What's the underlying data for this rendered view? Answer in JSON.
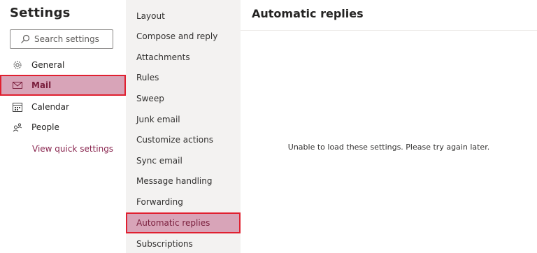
{
  "settings": {
    "title": "Settings",
    "search_placeholder": "Search settings",
    "nav": [
      {
        "label": "General",
        "icon": "gear-icon"
      },
      {
        "label": "Mail",
        "icon": "mail-icon",
        "selected": true
      },
      {
        "label": "Calendar",
        "icon": "calendar-icon"
      },
      {
        "label": "People",
        "icon": "people-icon"
      }
    ],
    "view_quick_settings": "View quick settings"
  },
  "mail_menu": {
    "items": [
      "Layout",
      "Compose and reply",
      "Attachments",
      "Rules",
      "Sweep",
      "Junk email",
      "Customize actions",
      "Sync email",
      "Message handling",
      "Forwarding",
      "Automatic replies",
      "Subscriptions"
    ],
    "selected": "Automatic replies"
  },
  "content": {
    "title": "Automatic replies",
    "message": "Unable to load these settings. Please try again later."
  },
  "colors": {
    "accent": "#8a2750",
    "selection_bg": "#d8a4b8",
    "highlight_border": "#e02030"
  }
}
